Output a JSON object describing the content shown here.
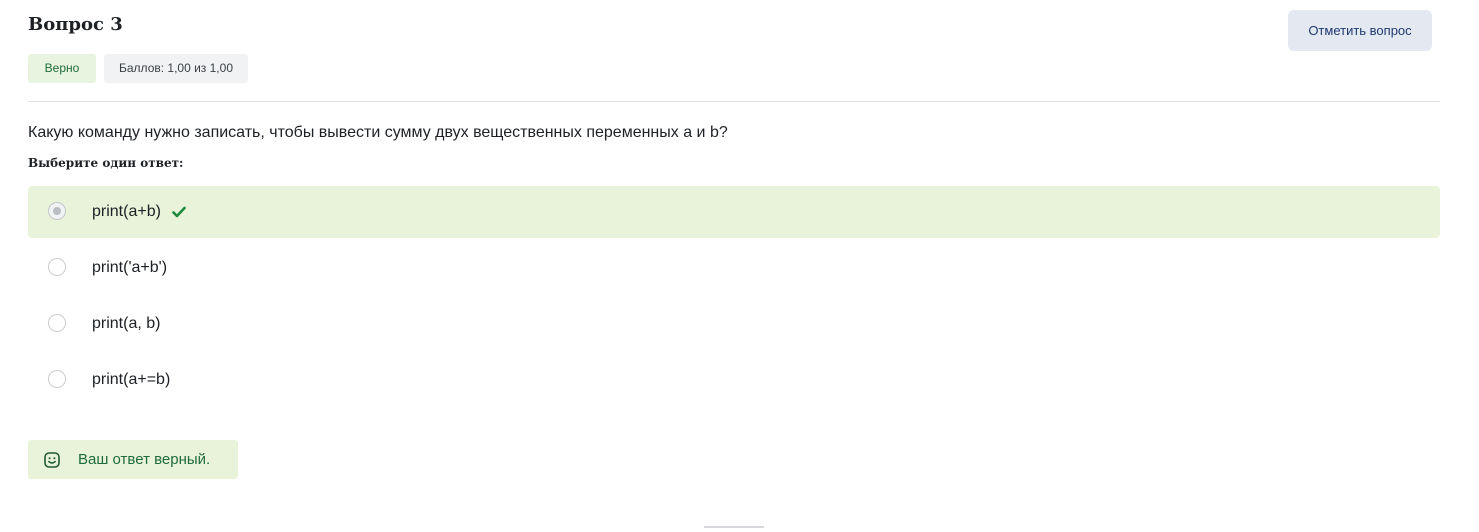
{
  "question": {
    "title": "Вопрос 3",
    "status_badge": "Верно",
    "grade_badge": "Баллов: 1,00 из 1,00",
    "flag_button": "Отметить вопрос",
    "text": "Какую команду нужно записать, чтобы вывести сумму двух вещественных переменных a и b?",
    "prompt": "Выберите один ответ:"
  },
  "answers": [
    {
      "label": "print(a+b)",
      "selected": true,
      "correct": true
    },
    {
      "label": "print('a+b')",
      "selected": false,
      "correct": false
    },
    {
      "label": "print(a, b)",
      "selected": false,
      "correct": false
    },
    {
      "label": "print(a+=b)",
      "selected": false,
      "correct": false
    }
  ],
  "feedback": {
    "text": "Ваш ответ верный.",
    "icon": "smile-icon"
  },
  "colors": {
    "correct_bg": "#e8f3da",
    "correct_text": "#1f6b3a",
    "check_icon": "#1f8a3c",
    "flag_button_bg": "#e4e8f1",
    "flag_button_text": "#1d3a6e"
  }
}
